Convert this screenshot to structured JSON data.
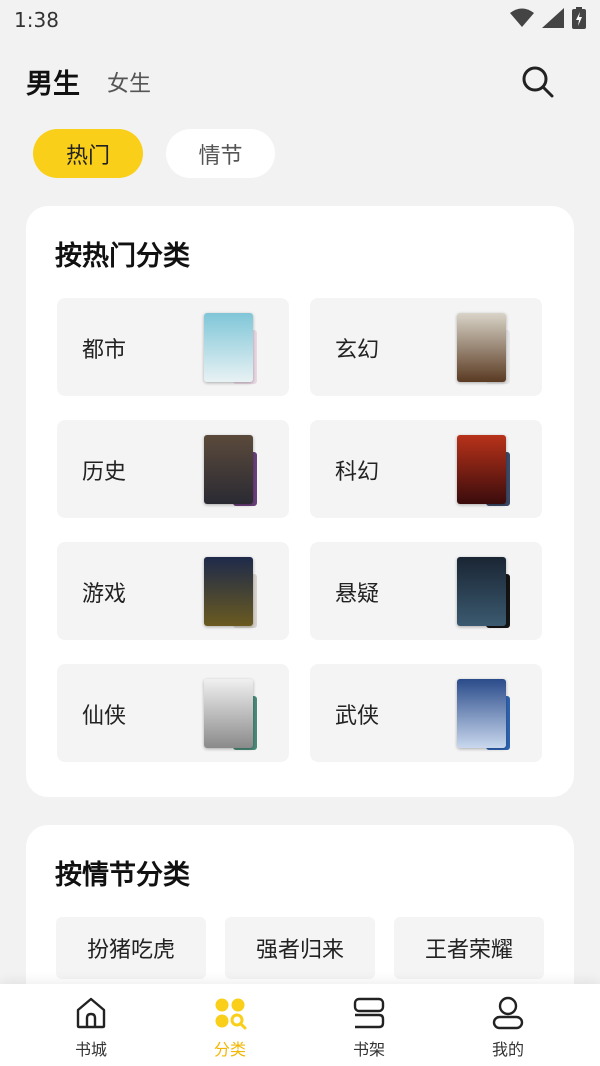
{
  "status": {
    "time": "1:38"
  },
  "header": {
    "tab_male": "男生",
    "tab_female": "女生"
  },
  "pills": {
    "hot": "热门",
    "plot": "情节"
  },
  "hot_section": {
    "title": "按热门分类",
    "items": [
      {
        "label": "都市",
        "cover_colors": [
          "#7fc6d8",
          "#e9d7e3"
        ]
      },
      {
        "label": "玄幻",
        "cover_colors": [
          "#5a3a22",
          "#e6e6e6"
        ]
      },
      {
        "label": "历史",
        "cover_colors": [
          "#5b4a3b",
          "#6a3f7a"
        ]
      },
      {
        "label": "科幻",
        "cover_colors": [
          "#3a0c0c",
          "#3c4a66"
        ]
      },
      {
        "label": "游戏",
        "cover_colors": [
          "#1e2a4a",
          "#d8d4cc"
        ]
      },
      {
        "label": "悬疑",
        "cover_colors": [
          "#1a2533",
          "#141414"
        ]
      },
      {
        "label": "仙侠",
        "cover_colors": [
          "#e6e6e6",
          "#4a8a78"
        ]
      },
      {
        "label": "武侠",
        "cover_colors": [
          "#2a4b8a",
          "#2f63b0"
        ]
      }
    ]
  },
  "plot_section": {
    "title": "按情节分类",
    "tags": [
      "扮猪吃虎",
      "强者归来",
      "王者荣耀"
    ]
  },
  "nav": {
    "items": [
      {
        "label": "书城",
        "icon": "home-icon"
      },
      {
        "label": "分类",
        "icon": "category-icon"
      },
      {
        "label": "书架",
        "icon": "bookshelf-icon"
      },
      {
        "label": "我的",
        "icon": "profile-icon"
      }
    ]
  },
  "colors": {
    "accent": "#f9cf19",
    "active_label": "#f2b705",
    "background": "#f2f2f2"
  }
}
